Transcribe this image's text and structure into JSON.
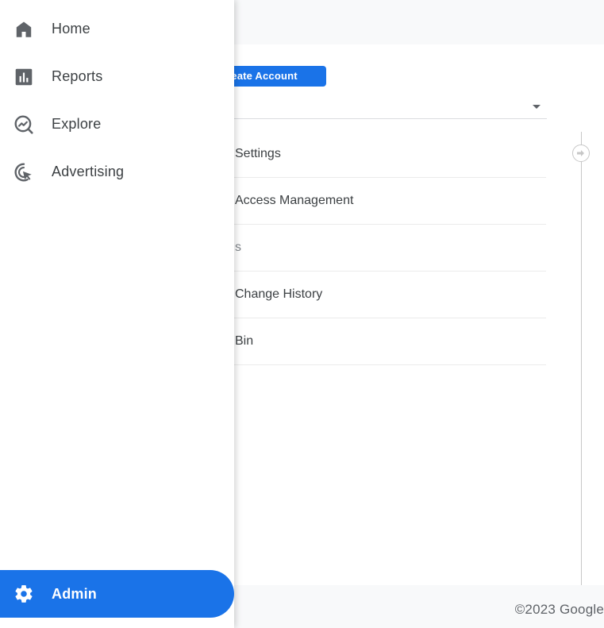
{
  "nav": {
    "items": [
      {
        "label": "Home",
        "icon": "home-icon"
      },
      {
        "label": "Reports",
        "icon": "bar-chart-icon"
      },
      {
        "label": "Explore",
        "icon": "explore-icon"
      },
      {
        "label": "Advertising",
        "icon": "advertising-cursor-icon"
      }
    ],
    "admin": {
      "label": "Admin",
      "icon": "gear-icon"
    }
  },
  "main": {
    "create_account_label": "reate Account",
    "settings": [
      {
        "label": "Settings"
      },
      {
        "label": "Access Management"
      },
      {
        "label": "s"
      },
      {
        "label": "Change History"
      },
      {
        "label": "Bin"
      }
    ]
  },
  "footer": {
    "copyright": "©2023 Google"
  },
  "colors": {
    "accent": "#1a73e8",
    "text": "#3c4043",
    "icon": "#5f6368"
  }
}
